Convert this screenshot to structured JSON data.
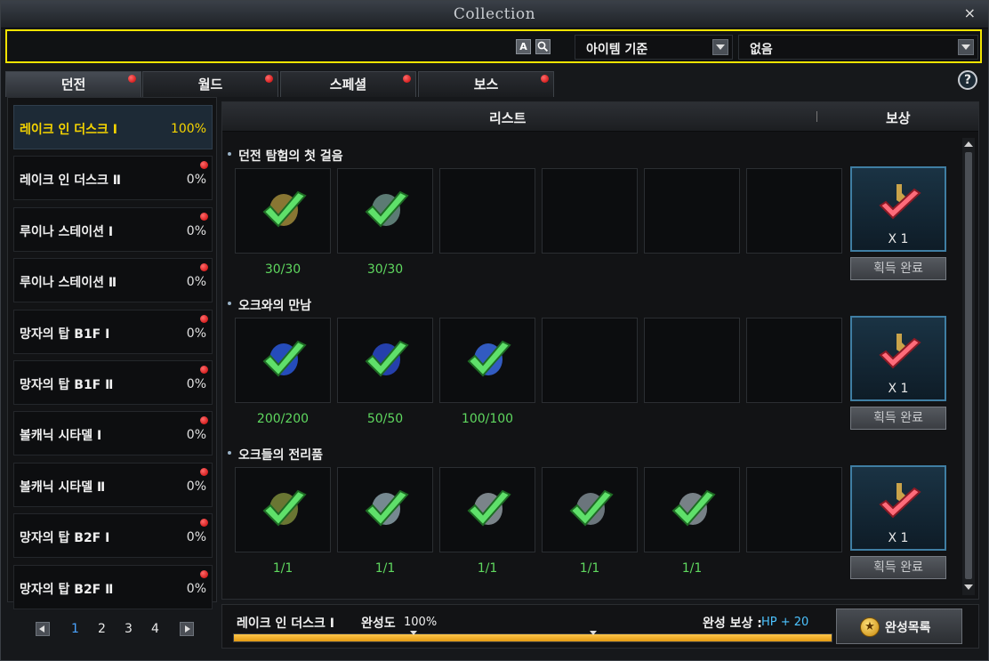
{
  "window": {
    "title": "Collection",
    "close": "×"
  },
  "search": {
    "value": "",
    "btn_a": "A",
    "filter_sort": "아이템 기준",
    "filter_status": "없음"
  },
  "tabs": [
    {
      "label": "던전",
      "active": true,
      "alert": true
    },
    {
      "label": "월드",
      "alert": true
    },
    {
      "label": "스페셜",
      "alert": true
    },
    {
      "label": "보스",
      "alert": true
    }
  ],
  "help": "?",
  "dungeons": [
    {
      "name": "레이크 인 더스크 Ⅰ",
      "pct": "100%",
      "active": true
    },
    {
      "name": "레이크 인 더스크 Ⅱ",
      "pct": "0%"
    },
    {
      "name": "루이나 스테이션 Ⅰ",
      "pct": "0%"
    },
    {
      "name": "루이나 스테이션 Ⅱ",
      "pct": "0%"
    },
    {
      "name": "망자의 탑 B1F Ⅰ",
      "pct": "0%"
    },
    {
      "name": "망자의 탑 B1F Ⅱ",
      "pct": "0%"
    },
    {
      "name": "볼캐닉 시타델 Ⅰ",
      "pct": "0%"
    },
    {
      "name": "볼캐닉 시타델 Ⅱ",
      "pct": "0%"
    },
    {
      "name": "망자의 탑 B2F Ⅰ",
      "pct": "0%"
    },
    {
      "name": "망자의 탑 B2F Ⅱ",
      "pct": "0%"
    }
  ],
  "pager": {
    "pages": [
      "1",
      "2",
      "3",
      "4"
    ],
    "current": "1"
  },
  "list_header": {
    "list": "리스트",
    "reward": "보상"
  },
  "sections": [
    {
      "title": "던전 탐험의 첫 걸음",
      "items": [
        {
          "count": "30/30",
          "icon": "ore-icon",
          "color": "#a08a3a"
        },
        {
          "count": "30/30",
          "icon": "crystal-icon",
          "color": "#6b8f86"
        }
      ],
      "reward_qty": "X 1",
      "reward_btn": "획득 완료"
    },
    {
      "title": "오크와의 만남",
      "items": [
        {
          "count": "200/200",
          "icon": "blue-orb-icon",
          "color": "#2a58d8"
        },
        {
          "count": "50/50",
          "icon": "blue-orb-icon",
          "color": "#2a4ac8"
        },
        {
          "count": "100/100",
          "icon": "blue-orb-icon",
          "color": "#3a6ae0"
        }
      ],
      "reward_qty": "X 1",
      "reward_btn": "획득 완료"
    },
    {
      "title": "오크들의 전리품",
      "items": [
        {
          "count": "1/1",
          "icon": "glove-icon",
          "color": "#7b8a3a"
        },
        {
          "count": "1/1",
          "icon": "helmet-icon",
          "color": "#8aa0a8"
        },
        {
          "count": "1/1",
          "icon": "armor-icon",
          "color": "#8f9aa0"
        },
        {
          "count": "1/1",
          "icon": "gauntlet-icon",
          "color": "#7d888f"
        },
        {
          "count": "1/1",
          "icon": "boots-icon",
          "color": "#8c969c"
        }
      ],
      "reward_qty": "X 1",
      "reward_btn": "획득 완료"
    }
  ],
  "footer": {
    "dungeon": "레이크 인 더스크 Ⅰ",
    "completion_label": "완성도",
    "completion": "100%",
    "completion_value": 100,
    "reward_label": "완성 보상 :",
    "reward_value": "HP + 20",
    "complete_btn": "완성목록"
  },
  "colors": {
    "accent": "#f5d400",
    "done": "#5fd85f",
    "link": "#4cc3ff",
    "alert": "#c40000"
  }
}
